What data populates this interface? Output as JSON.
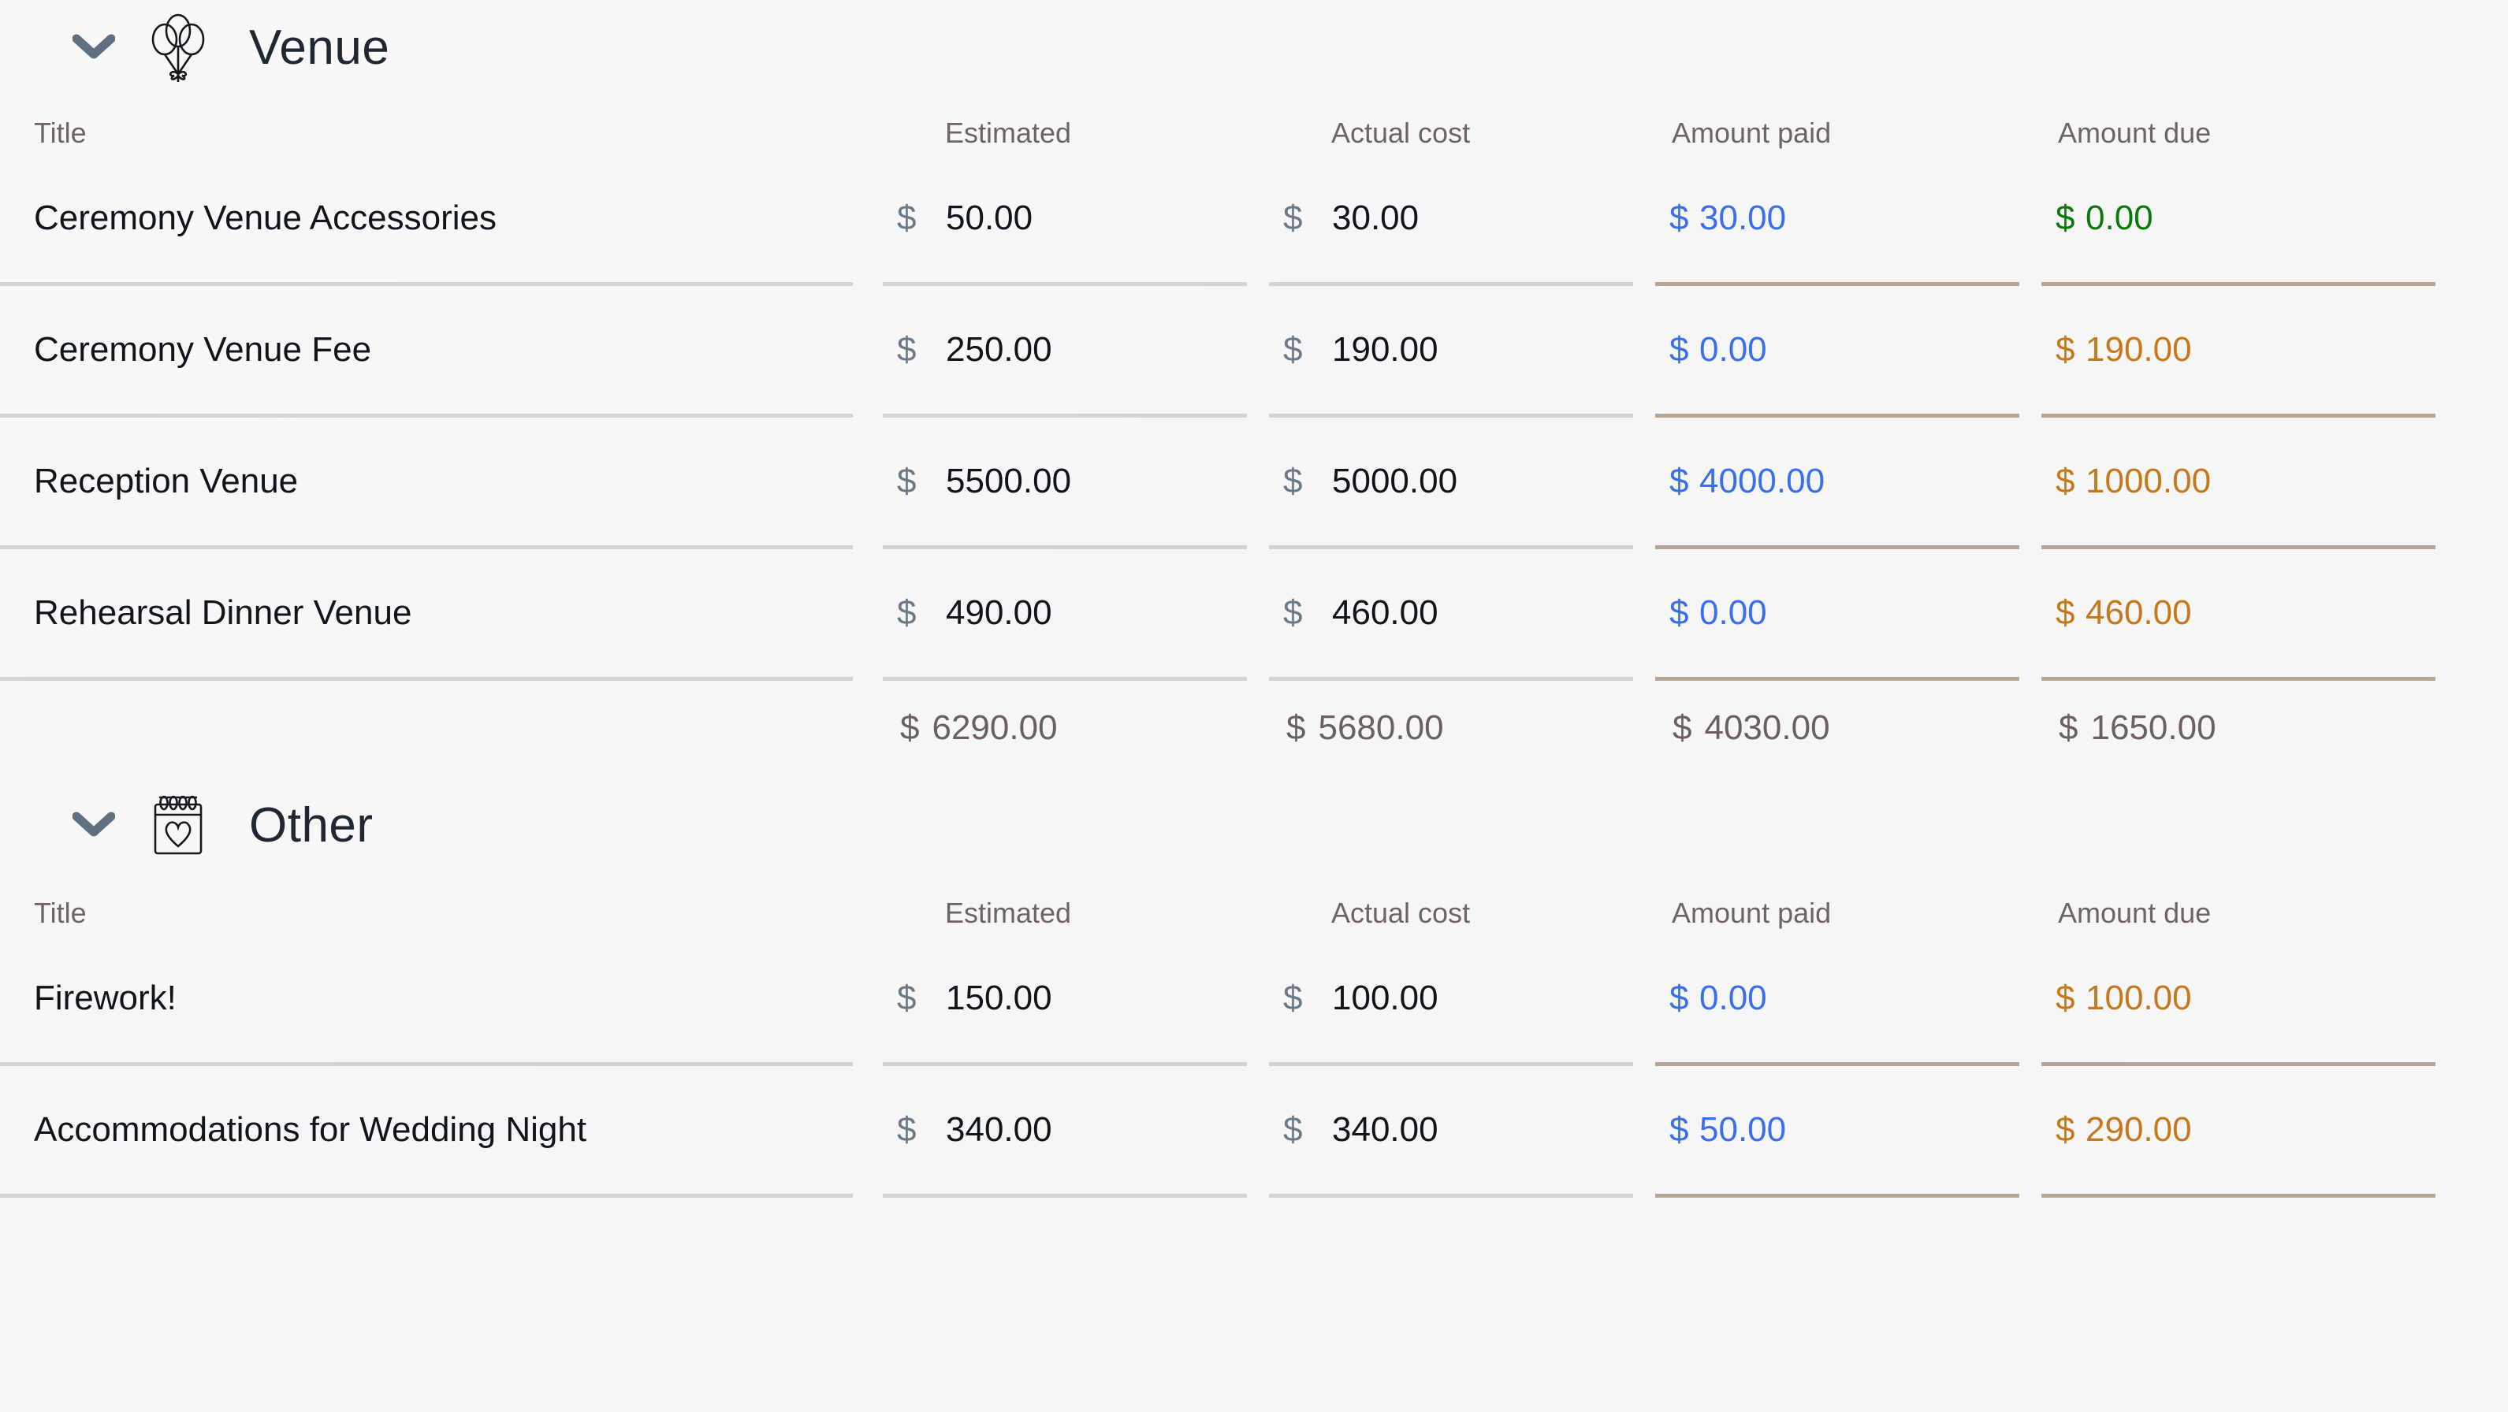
{
  "columns": {
    "title": "Title",
    "estimated": "Estimated",
    "actual": "Actual cost",
    "paid": "Amount paid",
    "due": "Amount due"
  },
  "currency_symbol": "$",
  "colors": {
    "background": "#f7f7f8",
    "title_text": "#10151c",
    "header_text": "#6f6464",
    "currency_symbol": "#6c7a88",
    "amount_paid": "#3a6fee",
    "amount_due_outstanding": "#c8781a",
    "amount_due_settled": "#0b7a0b",
    "total_text": "#6b5f60",
    "row_underline": "#d3d3d5",
    "row_underline_tan": "#b6a695",
    "chevron": "#5f7180"
  },
  "sections": [
    {
      "id": "venue",
      "title": "Venue",
      "icon": "balloons-icon",
      "chevron": "chevron-down-icon",
      "expanded": true,
      "rows": [
        {
          "title": "Ceremony Venue Accessories",
          "estimated": "50.00",
          "actual": "30.00",
          "paid": "30.00",
          "due": "0.00",
          "due_state": "settled"
        },
        {
          "title": "Ceremony Venue Fee",
          "estimated": "250.00",
          "actual": "190.00",
          "paid": "0.00",
          "due": "190.00",
          "due_state": "outstanding"
        },
        {
          "title": "Reception Venue",
          "estimated": "5500.00",
          "actual": "5000.00",
          "paid": "4000.00",
          "due": "1000.00",
          "due_state": "outstanding"
        },
        {
          "title": "Rehearsal Dinner Venue",
          "estimated": "490.00",
          "actual": "460.00",
          "paid": "0.00",
          "due": "460.00",
          "due_state": "outstanding"
        }
      ],
      "totals": {
        "estimated": "6290.00",
        "actual": "5680.00",
        "paid": "4030.00",
        "due": "1650.00"
      }
    },
    {
      "id": "other",
      "title": "Other",
      "icon": "calendar-heart-icon",
      "chevron": "chevron-down-icon",
      "expanded": true,
      "rows": [
        {
          "title": "Firework!",
          "estimated": "150.00",
          "actual": "100.00",
          "paid": "0.00",
          "due": "100.00",
          "due_state": "outstanding"
        },
        {
          "title": "Accommodations for Wedding Night",
          "estimated": "340.00",
          "actual": "340.00",
          "paid": "50.00",
          "due": "290.00",
          "due_state": "outstanding"
        }
      ],
      "totals": null
    }
  ]
}
